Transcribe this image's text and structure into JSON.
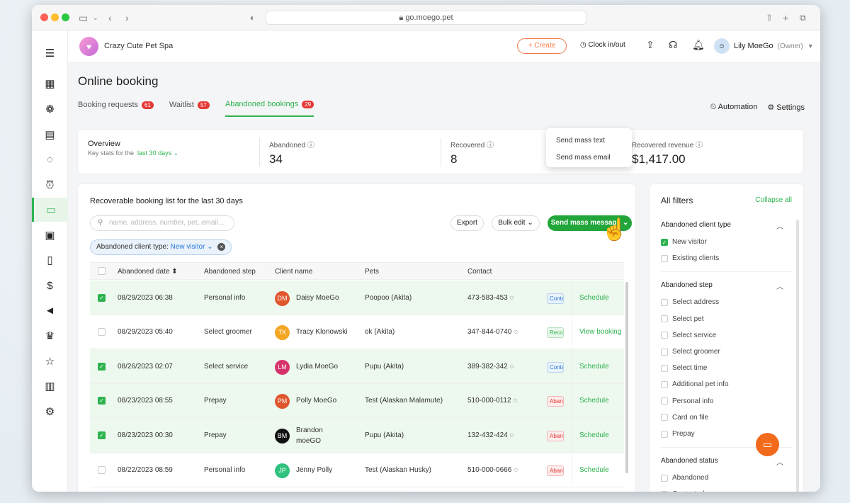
{
  "browser": {
    "url": "go.moego.pet"
  },
  "header": {
    "business_name": "Crazy Cute Pet Spa",
    "create_label": "Create",
    "clock_label": "Clock in/out",
    "user_name": "Lily MoeGo",
    "user_role": "(Owner)"
  },
  "page": {
    "title": "Online booking"
  },
  "tabs": [
    {
      "label": "Booking requests",
      "count": "61"
    },
    {
      "label": "Waitlist",
      "count": "57"
    },
    {
      "label": "Abandoned bookings",
      "count": "29"
    }
  ],
  "top_actions": {
    "automation": "Automation",
    "settings": "Settings"
  },
  "overview": {
    "title": "Overview",
    "subtitle": "Key stats for the",
    "range": "last 30 days",
    "abandoned_label": "Abandoned",
    "abandoned_value": "34",
    "recovered_label": "Recovered",
    "recovered_value": "8",
    "revenue_label": "Recovered revenue",
    "revenue_value": "$1,417.00"
  },
  "list": {
    "title": "Recoverable booking list for the last 30 days",
    "search_placeholder": "name, address, number, pet, email...",
    "export": "Export",
    "bulk_edit": "Bulk edit",
    "mass_message": "Send mass message",
    "chip_label": "Abandoned client type:",
    "chip_value": "New visitor"
  },
  "dropdown": {
    "items": [
      "Send mass text",
      "Send mass email"
    ]
  },
  "table": {
    "columns": [
      "Abandoned date",
      "Abandoned step",
      "Client name",
      "Pets",
      "Contact"
    ],
    "rows": [
      {
        "date": "08/29/2023 06:38",
        "step": "Personal info",
        "initials": "DM",
        "name": "Daisy MoeGo",
        "name2": "",
        "pets": "Poopoo (Akita)",
        "contact": "473-583-453",
        "tag": "Conta",
        "action": "Schedule",
        "color": "#e0562d",
        "checked": true
      },
      {
        "date": "08/29/2023 05:40",
        "step": "Select groomer",
        "initials": "TK",
        "name": "Tracy Klonowski",
        "name2": "",
        "pets": "ok (Akita)",
        "contact": "347-844-0740",
        "tag": "Reco",
        "action": "View booking",
        "color": "#f5a623",
        "checked": false
      },
      {
        "date": "08/26/2023 02:07",
        "step": "Select service",
        "initials": "LM",
        "name": "Lydia MoeGo",
        "name2": "",
        "pets": "Pupu (Akita)",
        "contact": "389-382-342",
        "tag": "Conta",
        "action": "Schedule",
        "color": "#d6336c",
        "checked": true
      },
      {
        "date": "08/23/2023 08:55",
        "step": "Prepay",
        "initials": "PM",
        "name": "Polly MoeGo",
        "name2": "",
        "pets": "Test (Alaskan Malamute)",
        "contact": "510-000-0112",
        "tag": "Aban",
        "action": "Schedule",
        "color": "#e0562d",
        "checked": true
      },
      {
        "date": "08/23/2023 00:30",
        "step": "Prepay",
        "initials": "BM",
        "name": "Brandon",
        "name2": "moeGO",
        "pets": "Pupu (Akita)",
        "contact": "132-432-424",
        "tag": "Aban",
        "action": "Schedule",
        "color": "#111111",
        "checked": true
      },
      {
        "date": "08/22/2023 08:59",
        "step": "Personal info",
        "initials": "JP",
        "name": "Jenny Polly",
        "name2": "",
        "pets": "Test (Alaskan Husky)",
        "contact": "510-000-0666",
        "tag": "Aban",
        "action": "Schedule",
        "color": "#2ec27e",
        "checked": false
      }
    ]
  },
  "filters": {
    "title": "All filters",
    "collapse_all": "Collapse all",
    "sections": [
      {
        "title": "Abandoned client type",
        "options": [
          {
            "label": "New visitor",
            "checked": true
          },
          {
            "label": "Existing clients",
            "checked": false
          }
        ]
      },
      {
        "title": "Abandoned step",
        "options": [
          {
            "label": "Select address",
            "checked": false
          },
          {
            "label": "Select pet",
            "checked": false
          },
          {
            "label": "Select service",
            "checked": false
          },
          {
            "label": "Select groomer",
            "checked": false
          },
          {
            "label": "Select time",
            "checked": false
          },
          {
            "label": "Additional pet info",
            "checked": false
          },
          {
            "label": "Personal info",
            "checked": false
          },
          {
            "label": "Card on file",
            "checked": false
          },
          {
            "label": "Prepay",
            "checked": false
          }
        ]
      },
      {
        "title": "Abandoned status",
        "options": [
          {
            "label": "Abandoned",
            "checked": false
          },
          {
            "label": "Contacted",
            "checked": false
          }
        ]
      }
    ]
  },
  "colors": {
    "accent": "#2eb34f",
    "create": "#f27a4a",
    "badge": "#e53935",
    "mass_button": "#22a53a"
  }
}
